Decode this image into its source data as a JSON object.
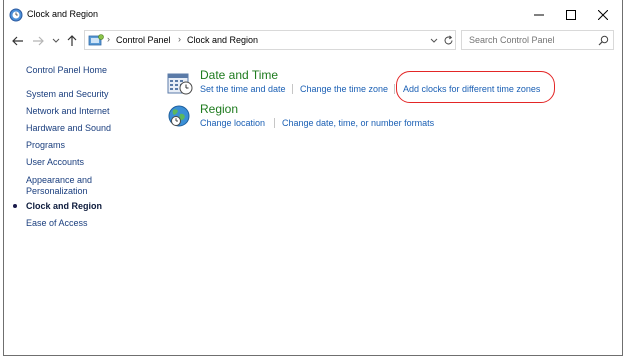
{
  "window": {
    "title": "Clock and Region"
  },
  "address": {
    "crumbs": [
      "Control Panel",
      "Clock and Region"
    ]
  },
  "search": {
    "placeholder": "Search Control Panel"
  },
  "sidebar": {
    "items": [
      {
        "label": "Control Panel Home"
      },
      {
        "label": "System and Security"
      },
      {
        "label": "Network and Internet"
      },
      {
        "label": "Hardware and Sound"
      },
      {
        "label": "Programs"
      },
      {
        "label": "User Accounts"
      },
      {
        "label": "Appearance and"
      },
      {
        "label": "Personalization"
      },
      {
        "label": "Clock and Region"
      },
      {
        "label": "Ease of Access"
      }
    ]
  },
  "categories": [
    {
      "title": "Date and Time",
      "tasks": [
        "Set the time and date",
        "Change the time zone",
        "Add clocks for different time zones"
      ]
    },
    {
      "title": "Region",
      "tasks": [
        "Change location",
        "Change date, time, or number formats"
      ]
    }
  ],
  "colors": {
    "link": "#1a5fb4",
    "category_title": "#1e7b1e",
    "highlight": "#e32626"
  }
}
